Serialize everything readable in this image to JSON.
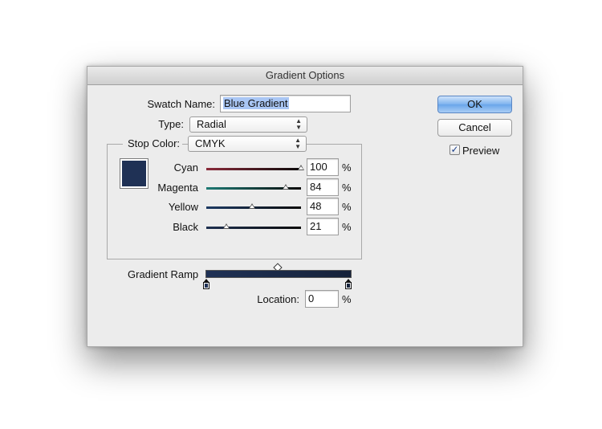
{
  "dialog": {
    "title": "Gradient Options",
    "swatch_name_label": "Swatch Name:",
    "swatch_name_value": "Blue Gradient",
    "type_label": "Type:",
    "type_value": "Radial",
    "stop_color_label": "Stop Color:",
    "stop_color_value": "CMYK",
    "swatch_color": "#1f3155",
    "sliders": [
      {
        "label": "Cyan",
        "value": "100",
        "unit": "%",
        "level": 1.0,
        "track_color": "#8a2a3a"
      },
      {
        "label": "Magenta",
        "value": "84",
        "unit": "%",
        "level": 0.84,
        "track_color": "#1e7a74"
      },
      {
        "label": "Yellow",
        "value": "48",
        "unit": "%",
        "level": 0.48,
        "track_color": "#1d3a63"
      },
      {
        "label": "Black",
        "value": "21",
        "unit": "%",
        "level": 0.21,
        "track_color": "#1e3050"
      }
    ],
    "gradient_ramp_label": "Gradient Ramp",
    "ramp_start_color": "#1f3155",
    "ramp_end_color": "#16223a",
    "location_label": "Location:",
    "location_value": "0",
    "location_unit": "%",
    "ok_label": "OK",
    "cancel_label": "Cancel",
    "preview_label": "Preview",
    "preview_checked": true,
    "preview_checkmark": "✓"
  }
}
